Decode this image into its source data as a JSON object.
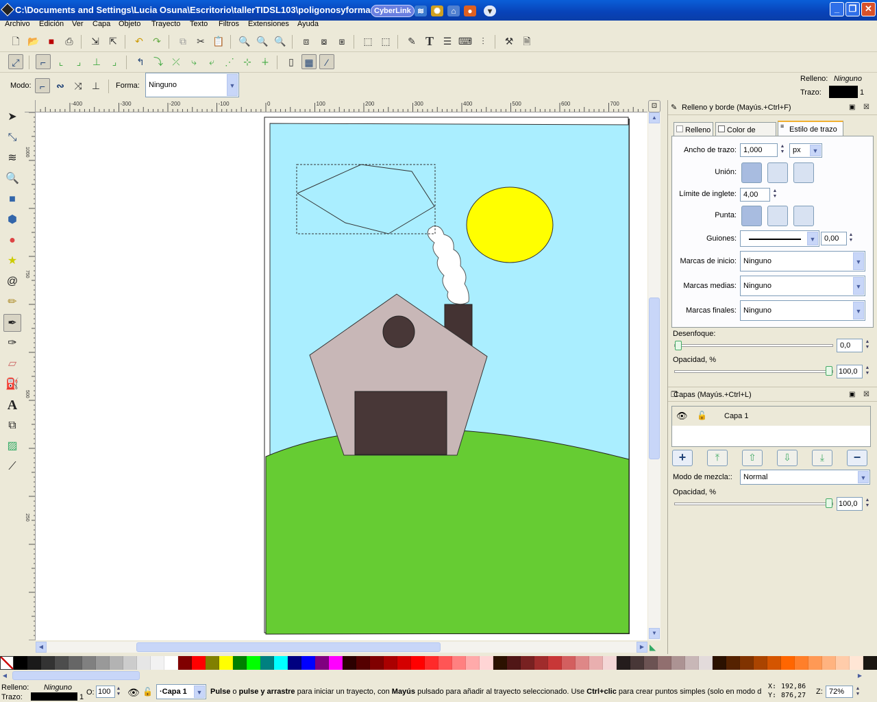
{
  "window": {
    "title": "C:\\Documents and Settings\\Lucia Osuna\\Escritorio\\tallerTIDSL103\\poligonosyformas",
    "cyberlink_label": "CyberLink"
  },
  "menu": [
    "Archivo",
    "Edición",
    "Ver",
    "Capa",
    "Objeto",
    "Trayecto",
    "Texto",
    "Filtros",
    "Extensiones",
    "Ayuda"
  ],
  "mode_bar": {
    "mode_label": "Modo:",
    "shape_label": "Forma:",
    "shape_value": "Ninguno"
  },
  "style_indicator": {
    "fill_label": "Relleno:",
    "fill_value": "Ninguno",
    "stroke_label": "Trazo:",
    "stroke_width": "1"
  },
  "ruler": {
    "h_ticks": [
      "-400",
      "-300",
      "-200",
      "-100",
      "0",
      "100",
      "200",
      "300",
      "400",
      "500",
      "600",
      "700"
    ],
    "v_ticks": [
      "1000",
      "750",
      "500",
      "250"
    ]
  },
  "fill_stroke_panel": {
    "title": "Relleno y borde (Mayús.+Ctrl+F)",
    "tabs": [
      "Relleno",
      "Color de trazo",
      "Estilo de trazo"
    ],
    "active_tab": "Estilo de trazo",
    "stroke_width_label": "Ancho de trazo:",
    "stroke_width_value": "1,000",
    "unit": "px",
    "join_label": "Unión:",
    "miter_label": "Límite de inglete:",
    "miter_value": "4,00",
    "cap_label": "Punta:",
    "dashes_label": "Guiones:",
    "dash_offset": "0,00",
    "start_markers_label": "Marcas de inicio:",
    "start_markers_value": "Ninguno",
    "mid_markers_label": "Marcas medias:",
    "mid_markers_value": "Ninguno",
    "end_markers_label": "Marcas finales:",
    "end_markers_value": "Ninguno",
    "blur_label": "Desenfoque:",
    "blur_value": "0,0",
    "opacity_label": "Opacidad, %",
    "opacity_value": "100,0"
  },
  "layers_panel": {
    "title": "Capas (Mayús.+Ctrl+L)",
    "layer_name": "Capa 1",
    "blend_label": "Modo de mezcla::",
    "blend_value": "Normal",
    "opacity_label": "Opacidad, %",
    "opacity_value": "100,0"
  },
  "palette": [
    "#000000",
    "#1a1a1a",
    "#333333",
    "#4d4d4d",
    "#666666",
    "#808080",
    "#999999",
    "#b3b3b3",
    "#cccccc",
    "#e6e6e6",
    "#f2f2f2",
    "#ffffff",
    "#800000",
    "#ff0000",
    "#808000",
    "#ffff00",
    "#008000",
    "#00ff00",
    "#008080",
    "#00ffff",
    "#000080",
    "#0000ff",
    "#800080",
    "#ff00ff",
    "#2b0000",
    "#550000",
    "#800000",
    "#aa0000",
    "#d40000",
    "#ff0000",
    "#ff2a2a",
    "#ff5555",
    "#ff8080",
    "#ffaaaa",
    "#ffd5d5",
    "#2b1100",
    "#501616",
    "#782121",
    "#a02c2c",
    "#c83737",
    "#d35f5f",
    "#de8787",
    "#e9afaf",
    "#f4d7d7",
    "#241c1c",
    "#483737",
    "#6c5353",
    "#916f6f",
    "#ac9393",
    "#c8b7b7",
    "#e3dbdb",
    "#2b1100",
    "#552200",
    "#803300",
    "#aa4400",
    "#d45500",
    "#ff6600",
    "#ff7f2a",
    "#ff9955",
    "#ffb380",
    "#ffccaa",
    "#ffe6d5",
    "#1c1712"
  ],
  "status": {
    "fill_label": "Relleno:",
    "fill_value": "Ninguno",
    "stroke_label": "Trazo:",
    "stroke_width": "1",
    "opacity_label": "O:",
    "opacity_value": "100",
    "layer_value": "·Capa 1",
    "message_b1": "Pulse",
    "message_t1": " o ",
    "message_b2": "pulse y arrastre",
    "message_t2": " para iniciar un trayecto, con ",
    "message_b3": "Mayús",
    "message_t3": " pulsado para añadir al trayecto seleccionado. Use ",
    "message_b4": "Ctrl+clic",
    "message_t4": " para crear puntos simples (solo en modo d",
    "x_label": "X:",
    "x_value": "192,86",
    "y_label": "Y:",
    "y_value": "876,27",
    "zoom_label": "Z:",
    "zoom_value": "72%"
  }
}
